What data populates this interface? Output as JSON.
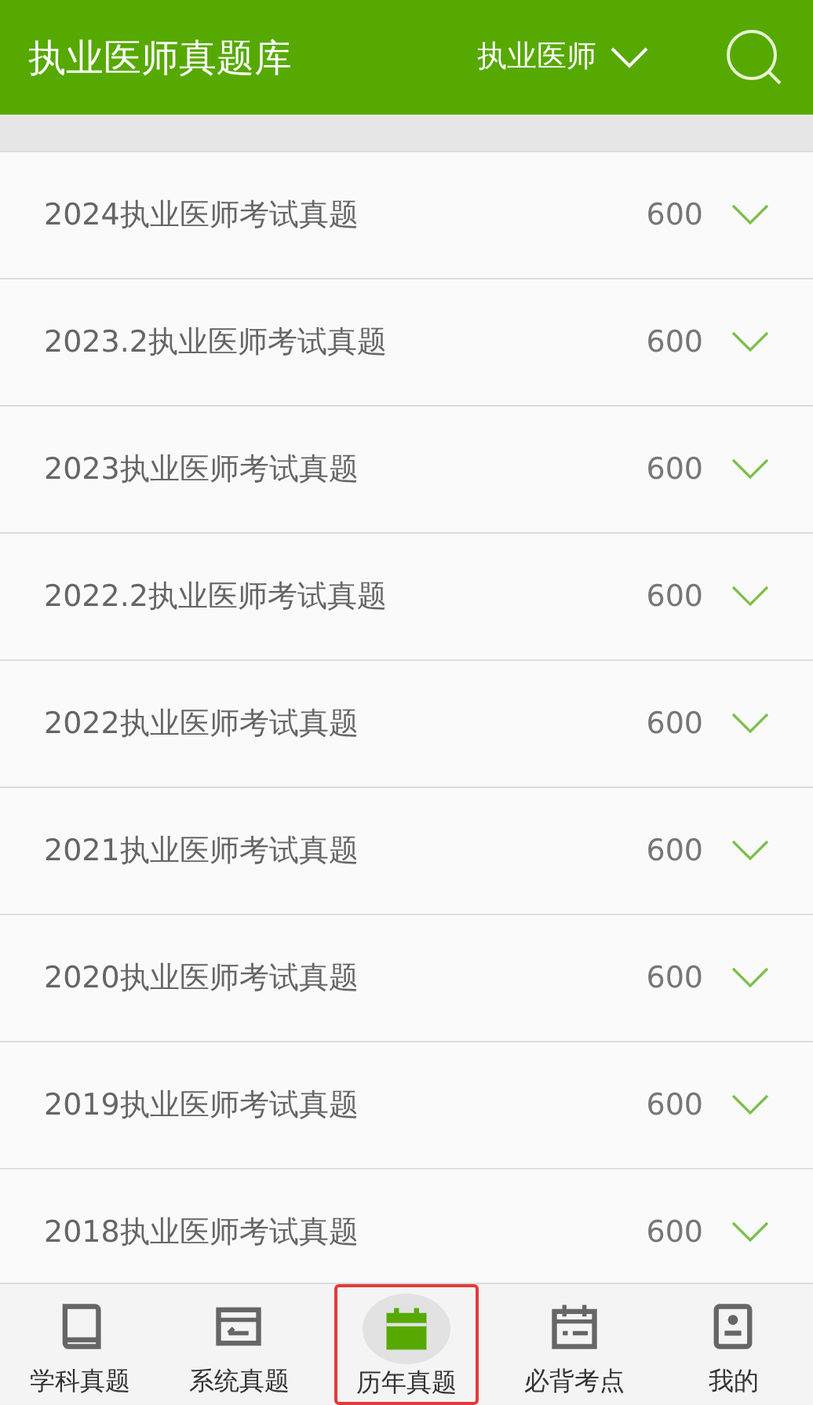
{
  "header": {
    "title": "执业医师真题库",
    "category": "执业医师"
  },
  "list": [
    {
      "title": "2024执业医师考试真题",
      "count": "600"
    },
    {
      "title": "2023.2执业医师考试真题",
      "count": "600"
    },
    {
      "title": "2023执业医师考试真题",
      "count": "600"
    },
    {
      "title": "2022.2执业医师考试真题",
      "count": "600"
    },
    {
      "title": "2022执业医师考试真题",
      "count": "600"
    },
    {
      "title": "2021执业医师考试真题",
      "count": "600"
    },
    {
      "title": "2020执业医师考试真题",
      "count": "600"
    },
    {
      "title": "2019执业医师考试真题",
      "count": "600"
    },
    {
      "title": "2018执业医师考试真题",
      "count": "600"
    }
  ],
  "tabbar": [
    {
      "label": "学科真题",
      "kind": "book",
      "selected": false
    },
    {
      "label": "系统真题",
      "kind": "frame",
      "selected": false
    },
    {
      "label": "历年真题",
      "kind": "calendar",
      "selected": true
    },
    {
      "label": "必背考点",
      "kind": "planner",
      "selected": false
    },
    {
      "label": "我的",
      "kind": "profile",
      "selected": false
    }
  ]
}
